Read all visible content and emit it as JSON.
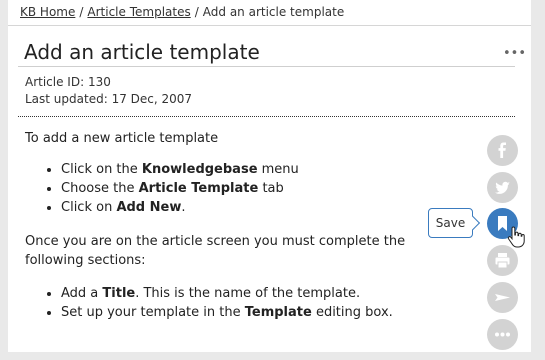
{
  "breadcrumb": {
    "home": "KB Home",
    "separator": "/",
    "templates": "Article Templates",
    "current": "Add an article template"
  },
  "article": {
    "title": "Add an article template",
    "more_label": "•••",
    "id_label": "Article ID: 130",
    "updated_label": "Last updated: 17 Dec, 2007",
    "intro": "To add a new article template",
    "steps1": [
      {
        "pre": "Click on the ",
        "bold": "Knowledgebase",
        "post": " menu"
      },
      {
        "pre": "Choose the ",
        "bold": "Article Template",
        "post": " tab"
      },
      {
        "pre": "Click on ",
        "bold": "Add New",
        "post": "."
      }
    ],
    "para2": "Once you are on the article screen you must complete the following sections:",
    "steps2": [
      {
        "pre": "Add a ",
        "bold": "Title",
        "post": ". This is the name of the template."
      },
      {
        "pre": "Set up your template in the ",
        "bold": "Template",
        "post": " editing box."
      }
    ]
  },
  "share": {
    "tooltip": "Save",
    "icons": [
      "facebook-icon",
      "twitter-icon",
      "bookmark-icon",
      "print-icon",
      "email-icon",
      "more-icon"
    ],
    "active_color": "#3a7bbf",
    "inactive_color": "#d3d3d3"
  }
}
